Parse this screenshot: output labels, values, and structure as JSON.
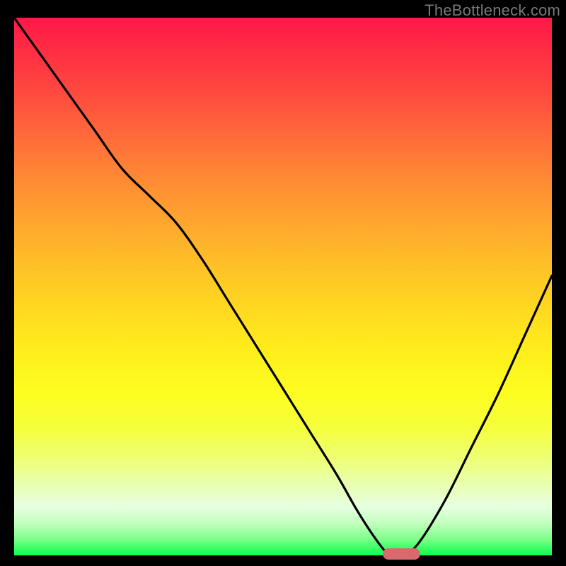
{
  "watermark": "TheBottleneck.com",
  "colors": {
    "frame": "#000000",
    "curve_stroke": "#000000",
    "marker": "#d86a6e"
  },
  "chart_data": {
    "type": "line",
    "title": "",
    "xlabel": "",
    "ylabel": "",
    "xlim": [
      0,
      100
    ],
    "ylim": [
      0,
      100
    ],
    "grid": false,
    "legend": false,
    "background": "red-to-green vertical gradient (high=top=red, low=bottom=green)",
    "series": [
      {
        "name": "bottleneck-curve",
        "x": [
          0,
          5,
          10,
          15,
          20,
          25,
          30,
          35,
          40,
          45,
          50,
          55,
          60,
          64,
          68,
          70,
          72,
          75,
          80,
          85,
          90,
          95,
          100
        ],
        "values": [
          100,
          93,
          86,
          79,
          72,
          67,
          62,
          55,
          47,
          39,
          31,
          23,
          15,
          8,
          2,
          0,
          0,
          2,
          10,
          20,
          30,
          41,
          52
        ]
      }
    ],
    "marker": {
      "name": "optimal-range",
      "x_start": 68.5,
      "x_end": 75.5,
      "y": 0
    }
  }
}
